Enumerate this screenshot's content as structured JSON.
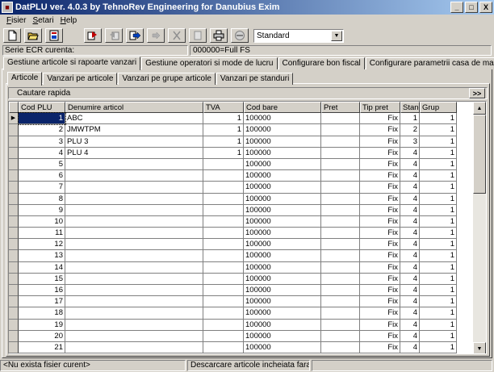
{
  "window": {
    "title": "DatPLU ver. 4.0.3 by TehnoRev Engineering for Danubius Exim",
    "minimize": "_",
    "maximize": "□",
    "close": "X"
  },
  "menu": [
    {
      "label": "Fisier",
      "accel": "F",
      "rest": "isier"
    },
    {
      "label": "Setari",
      "accel": "S",
      "rest": "etari"
    },
    {
      "label": "Help",
      "accel": "H",
      "rest": "elp"
    }
  ],
  "toolbar": {
    "combo_value": "Standard",
    "combo_arrow": "▼"
  },
  "serie": {
    "label": "Serie ECR curenta:",
    "value": "000000=Full FS"
  },
  "main_tabs": [
    "Gestiune articole si rapoarte vanzari",
    "Gestiune operatori si mode de lucru",
    "Configurare bon fiscal",
    "Configurare parametrii casa de marcat"
  ],
  "sub_tabs": [
    "Articole",
    "Vanzari pe articole",
    "Vanzari pe grupe articole",
    "Vanzari pe standuri"
  ],
  "search": {
    "label": "Cautare rapida",
    "button": ">>"
  },
  "grid": {
    "columns": [
      "Cod PLU",
      "Denumire articol",
      "TVA",
      "Cod bare",
      "Pret",
      "Tip pret",
      "Stand",
      "Grup"
    ],
    "row_indicator": "▶",
    "rows": [
      [
        "1",
        "ABC",
        "1",
        "100000",
        "",
        "Fix",
        "1",
        "1"
      ],
      [
        "2",
        "JMWTPM",
        "1",
        "100000",
        "",
        "Fix",
        "2",
        "1"
      ],
      [
        "3",
        "PLU 3",
        "1",
        "100000",
        "",
        "Fix",
        "3",
        "1"
      ],
      [
        "4",
        "PLU 4",
        "1",
        "100000",
        "",
        "Fix",
        "4",
        "1"
      ],
      [
        "5",
        "",
        "",
        "100000",
        "",
        "Fix",
        "4",
        "1"
      ],
      [
        "6",
        "",
        "",
        "100000",
        "",
        "Fix",
        "4",
        "1"
      ],
      [
        "7",
        "",
        "",
        "100000",
        "",
        "Fix",
        "4",
        "1"
      ],
      [
        "8",
        "",
        "",
        "100000",
        "",
        "Fix",
        "4",
        "1"
      ],
      [
        "9",
        "",
        "",
        "100000",
        "",
        "Fix",
        "4",
        "1"
      ],
      [
        "10",
        "",
        "",
        "100000",
        "",
        "Fix",
        "4",
        "1"
      ],
      [
        "11",
        "",
        "",
        "100000",
        "",
        "Fix",
        "4",
        "1"
      ],
      [
        "12",
        "",
        "",
        "100000",
        "",
        "Fix",
        "4",
        "1"
      ],
      [
        "13",
        "",
        "",
        "100000",
        "",
        "Fix",
        "4",
        "1"
      ],
      [
        "14",
        "",
        "",
        "100000",
        "",
        "Fix",
        "4",
        "1"
      ],
      [
        "15",
        "",
        "",
        "100000",
        "",
        "Fix",
        "4",
        "1"
      ],
      [
        "16",
        "",
        "",
        "100000",
        "",
        "Fix",
        "4",
        "1"
      ],
      [
        "17",
        "",
        "",
        "100000",
        "",
        "Fix",
        "4",
        "1"
      ],
      [
        "18",
        "",
        "",
        "100000",
        "",
        "Fix",
        "4",
        "1"
      ],
      [
        "19",
        "",
        "",
        "100000",
        "",
        "Fix",
        "4",
        "1"
      ],
      [
        "20",
        "",
        "",
        "100000",
        "",
        "Fix",
        "4",
        "1"
      ],
      [
        "21",
        "",
        "",
        "100000",
        "",
        "Fix",
        "4",
        "1"
      ]
    ]
  },
  "status": {
    "pane1": "<Nu exista fisier curent>",
    "pane2": "Descarcare articole incheiata fara erori",
    "pane3": ""
  },
  "colors": {
    "title_start": "#0a246a",
    "title_end": "#a6caf0",
    "face": "#d4d0c8",
    "selection": "#0a246a"
  }
}
